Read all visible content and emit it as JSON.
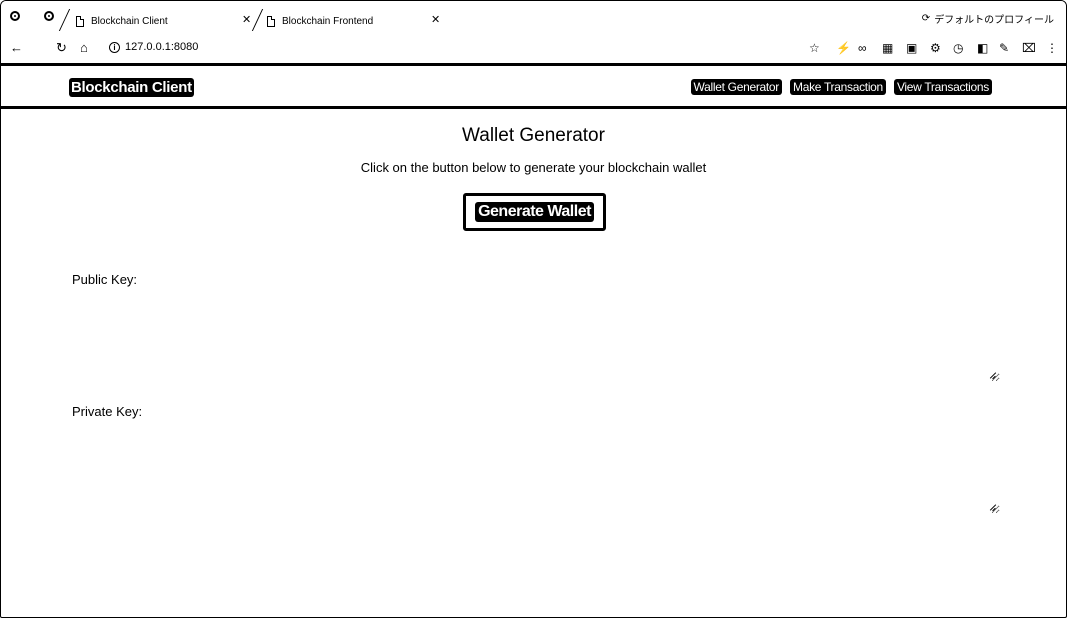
{
  "browser": {
    "tabs": [
      {
        "label": "Blockchain Client",
        "active": true
      },
      {
        "label": "Blockchain Frontend",
        "active": false
      }
    ],
    "profile_label": "デフォルトのプロフィール",
    "url": "127.0.0.1:8080"
  },
  "navbar": {
    "brand": "Blockchain Client",
    "links": [
      "Wallet Generator",
      "Make Transaction",
      "View Transactions"
    ]
  },
  "main": {
    "title": "Wallet Generator",
    "subtitle": "Click on the button below to generate your blockchain wallet",
    "generate_button": "Generate Wallet",
    "public_key_label": "Public Key:",
    "private_key_label": "Private Key:",
    "public_key_value": "",
    "private_key_value": ""
  }
}
